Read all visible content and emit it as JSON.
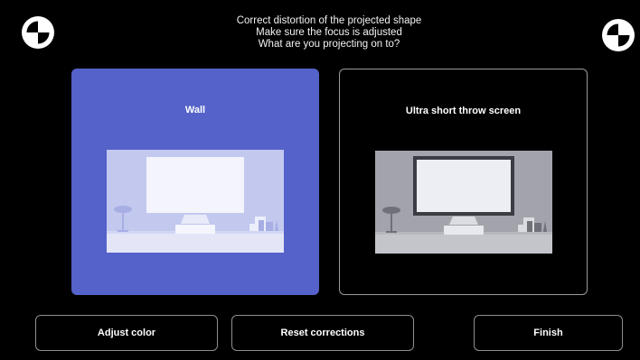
{
  "header": {
    "line1": "Correct distortion of the projected shape",
    "line2": "Make sure the focus is adjusted",
    "line3": "What are you projecting on to?"
  },
  "icons": {
    "left_target": "focus-target-icon",
    "right_target": "focus-target-icon"
  },
  "options": [
    {
      "label": "Wall",
      "selected": true,
      "illustration": "wall-projection-illustration"
    },
    {
      "label": "Ultra short throw screen",
      "selected": false,
      "illustration": "ust-screen-illustration"
    }
  ],
  "buttons": {
    "adjust_color": "Adjust color",
    "reset_corrections": "Reset corrections",
    "finish": "Finish"
  },
  "colors": {
    "background": "#000000",
    "selected_card": "#5462c9",
    "card_border": "#9a9a9a",
    "text": "#ffffff"
  }
}
